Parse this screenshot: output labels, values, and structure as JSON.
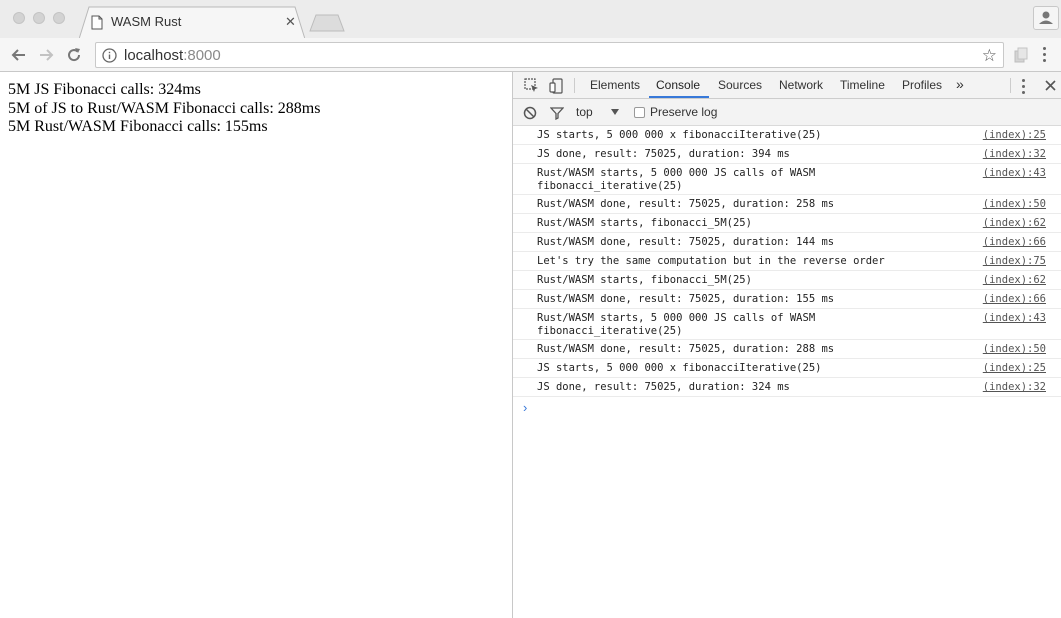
{
  "browser": {
    "tab": {
      "title": "WASM Rust",
      "close": "✕"
    },
    "address": {
      "host": "localhost",
      "port": ":8000"
    }
  },
  "page": {
    "lines": [
      "5M JS Fibonacci calls: 324ms",
      "5M of JS to Rust/WASM Fibonacci calls: 288ms",
      "5M Rust/WASM Fibonacci calls: 155ms"
    ]
  },
  "devtools": {
    "tabs": [
      "Elements",
      "Console",
      "Sources",
      "Network",
      "Timeline",
      "Profiles"
    ],
    "active_tab": "Console",
    "more": "»",
    "context": "top",
    "preserve_log": "Preserve log",
    "messages": [
      {
        "text": "JS starts, 5 000 000 x fibonacciIterative(25)",
        "src": "(index):25"
      },
      {
        "text": "JS done, result: 75025, duration: 394 ms",
        "src": "(index):32"
      },
      {
        "text": "Rust/WASM starts, 5 000 000 JS calls of WASM\nfibonacci_iterative(25)",
        "src": "(index):43"
      },
      {
        "text": "Rust/WASM done, result: 75025, duration: 258 ms",
        "src": "(index):50"
      },
      {
        "text": "Rust/WASM starts, fibonacci_5M(25)",
        "src": "(index):62"
      },
      {
        "text": "Rust/WASM done, result: 75025, duration: 144 ms",
        "src": "(index):66"
      },
      {
        "text": "Let's try the same computation but in the reverse order",
        "src": "(index):75"
      },
      {
        "text": "Rust/WASM starts, fibonacci_5M(25)",
        "src": "(index):62"
      },
      {
        "text": "Rust/WASM done, result: 75025, duration: 155 ms",
        "src": "(index):66"
      },
      {
        "text": "Rust/WASM starts, 5 000 000 JS calls of WASM\nfibonacci_iterative(25)",
        "src": "(index):43"
      },
      {
        "text": "Rust/WASM done, result: 75025, duration: 288 ms",
        "src": "(index):50"
      },
      {
        "text": "JS starts, 5 000 000 x fibonacciIterative(25)",
        "src": "(index):25"
      },
      {
        "text": "JS done, result: 75025, duration: 324 ms",
        "src": "(index):32"
      }
    ],
    "prompt": "›"
  }
}
